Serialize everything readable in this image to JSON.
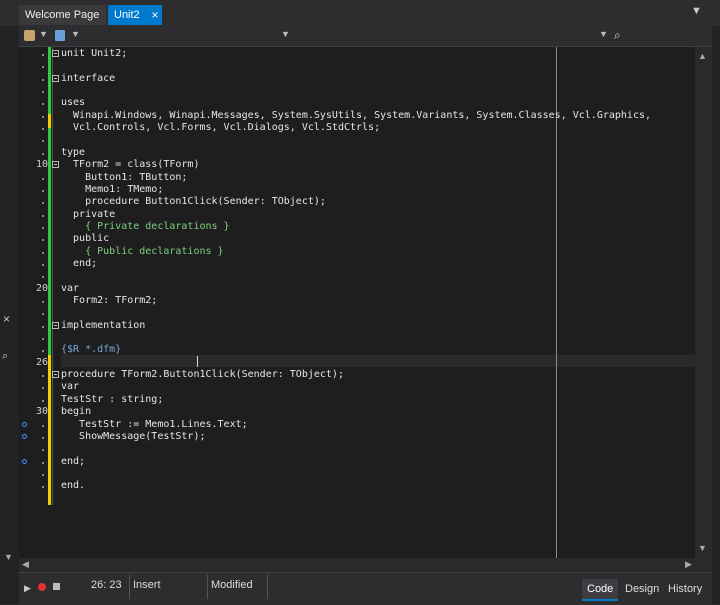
{
  "tabs": [
    {
      "label": "Welcome Page"
    },
    {
      "label": "Unit2"
    }
  ],
  "icons": {
    "close": "×",
    "chevron": "⌄",
    "search": "⌕"
  },
  "editor": {
    "lines": [
      {
        "num": "",
        "text": "unit Unit2;",
        "cls": "kw",
        "fold": true
      },
      {
        "num": "",
        "text": "",
        "cls": ""
      },
      {
        "num": "",
        "text": "interface",
        "cls": "kw",
        "fold": true
      },
      {
        "num": "",
        "text": "",
        "cls": ""
      },
      {
        "num": "",
        "text": "uses",
        "cls": "kw"
      },
      {
        "num": "",
        "text": "  Winapi.Windows, Winapi.Messages, System.SysUtils, System.Variants, System.Classes, Vcl.Graphics,",
        "cls": ""
      },
      {
        "num": "",
        "text": "  Vcl.Controls, Vcl.Forms, Vcl.Dialogs, Vcl.StdCtrls;",
        "cls": ""
      },
      {
        "num": "",
        "text": "",
        "cls": ""
      },
      {
        "num": "",
        "text": "type",
        "cls": "kw"
      },
      {
        "num": "10",
        "text": "  TForm2 = class(TForm)",
        "cls": "",
        "fold": true
      },
      {
        "num": "",
        "text": "    Button1: TButton;",
        "cls": ""
      },
      {
        "num": "",
        "text": "    Memo1: TMemo;",
        "cls": ""
      },
      {
        "num": "",
        "text": "    procedure Button1Click(Sender: TObject);",
        "cls": ""
      },
      {
        "num": "",
        "text": "  private",
        "cls": ""
      },
      {
        "num": "",
        "text": "    { Private declarations }",
        "cls": "cm"
      },
      {
        "num": "",
        "text": "  public",
        "cls": ""
      },
      {
        "num": "",
        "text": "    { Public declarations }",
        "cls": "cm"
      },
      {
        "num": "",
        "text": "  end;",
        "cls": ""
      },
      {
        "num": "",
        "text": "",
        "cls": ""
      },
      {
        "num": "20",
        "text": "var",
        "cls": "kw"
      },
      {
        "num": "",
        "text": "  Form2: TForm2;",
        "cls": ""
      },
      {
        "num": "",
        "text": "",
        "cls": ""
      },
      {
        "num": "",
        "text": "implementation",
        "cls": "kw",
        "fold": true
      },
      {
        "num": "",
        "text": "",
        "cls": ""
      },
      {
        "num": "",
        "text": "{$R *.dfm}",
        "cls": "dir"
      },
      {
        "num": "26",
        "text": "",
        "cls": ""
      },
      {
        "num": "",
        "text": "procedure TForm2.Button1Click(Sender: TObject);",
        "cls": "",
        "fold": true
      },
      {
        "num": "",
        "text": "var",
        "cls": ""
      },
      {
        "num": "",
        "text": "TestStr : string;",
        "cls": ""
      },
      {
        "num": "30",
        "text": "begin",
        "cls": ""
      },
      {
        "num": "",
        "text": "   TestStr := Memo1.Lines.Text;",
        "cls": "",
        "bp": true
      },
      {
        "num": "",
        "text": "   ShowMessage(TestStr);",
        "cls": "",
        "bp": true
      },
      {
        "num": "",
        "text": "",
        "cls": ""
      },
      {
        "num": "",
        "text": "end;",
        "cls": "",
        "bp": true
      },
      {
        "num": "",
        "text": "",
        "cls": ""
      },
      {
        "num": "",
        "text": "end.",
        "cls": "kw"
      }
    ]
  },
  "status": {
    "position": "26: 23",
    "mode": "Insert",
    "modified": "Modified"
  },
  "view_tabs": {
    "code": "Code",
    "design": "Design",
    "history": "History"
  }
}
